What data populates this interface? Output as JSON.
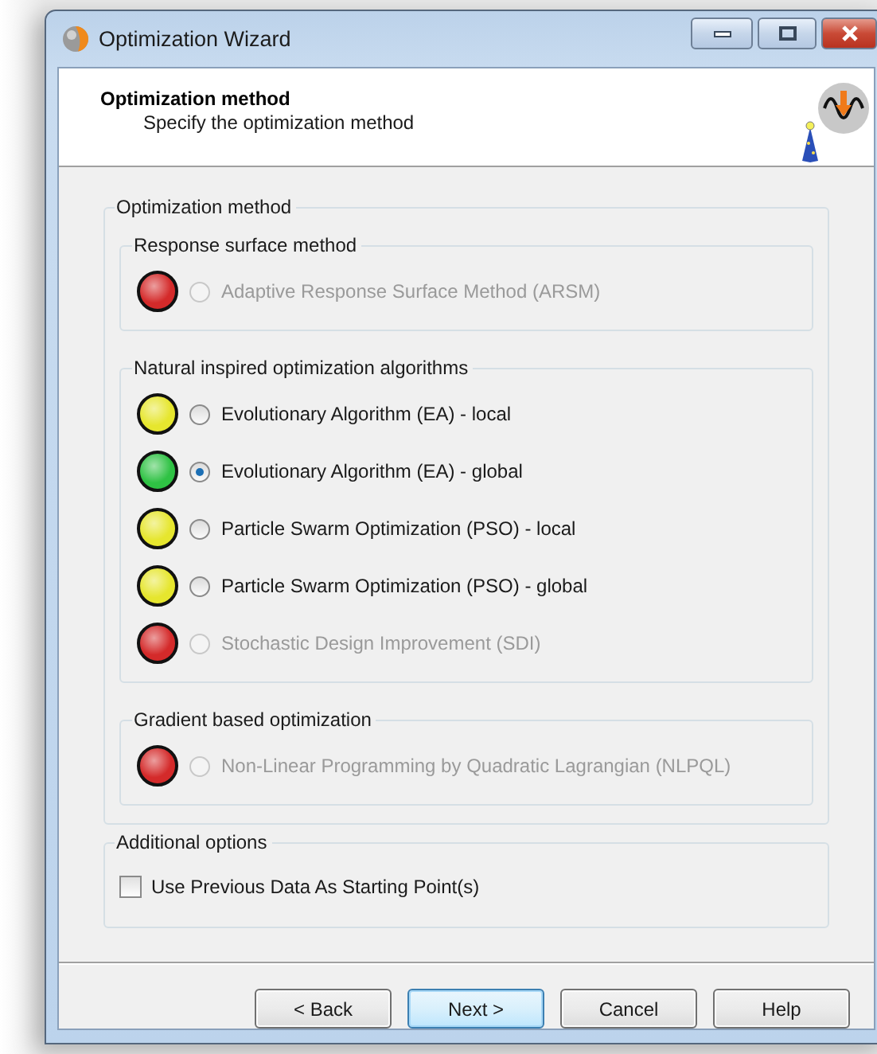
{
  "window": {
    "title": "Optimization Wizard"
  },
  "header": {
    "title": "Optimization method",
    "subtitle": "Specify the optimization method"
  },
  "method_group": {
    "label": "Optimization method",
    "groups": [
      {
        "label": "Response surface method",
        "options": [
          {
            "label": "Adaptive Response Surface Method (ARSM)",
            "color": "#d42a2a",
            "selected": false,
            "disabled": true
          }
        ]
      },
      {
        "label": "Natural inspired optimization algorithms",
        "options": [
          {
            "label": "Evolutionary Algorithm (EA) - local",
            "color": "#e6e62e",
            "selected": false,
            "disabled": false
          },
          {
            "label": "Evolutionary Algorithm (EA) - global",
            "color": "#2fc244",
            "selected": true,
            "disabled": false
          },
          {
            "label": "Particle Swarm Optimization (PSO) - local",
            "color": "#e6e62e",
            "selected": false,
            "disabled": false
          },
          {
            "label": "Particle Swarm Optimization (PSO) - global",
            "color": "#e6e62e",
            "selected": false,
            "disabled": false
          },
          {
            "label": "Stochastic Design Improvement (SDI)",
            "color": "#d42a2a",
            "selected": false,
            "disabled": true
          }
        ]
      },
      {
        "label": "Gradient based optimization",
        "options": [
          {
            "label": "Non-Linear Programming by Quadratic Lagrangian (NLPQL)",
            "color": "#d42a2a",
            "selected": false,
            "disabled": true
          }
        ]
      }
    ]
  },
  "additional_options": {
    "label": "Additional options",
    "checkbox": {
      "label": "Use Previous Data As Starting Point(s)",
      "checked": false
    }
  },
  "buttons": [
    {
      "label": "< Back",
      "default": false
    },
    {
      "label": "Next >",
      "default": true
    },
    {
      "label": "Cancel",
      "default": false
    },
    {
      "label": "Help",
      "default": false
    }
  ]
}
